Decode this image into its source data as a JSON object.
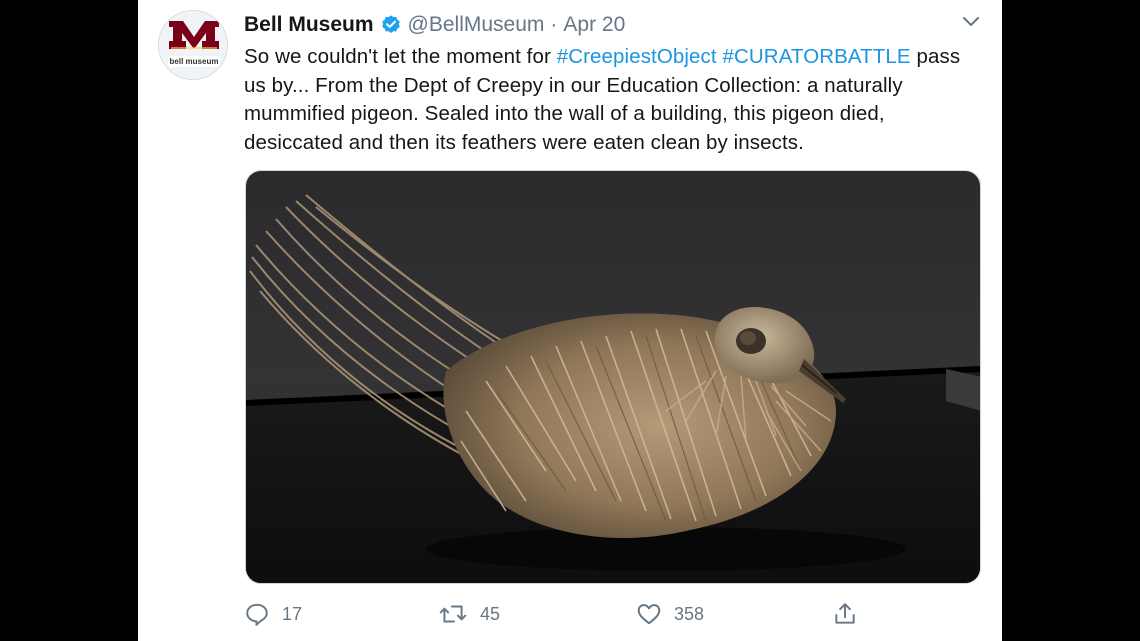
{
  "account": {
    "display_name": "Bell Museum",
    "handle": "@BellMuseum",
    "separator": "·",
    "date": "Apr 20",
    "avatar_logo_text": "bell museum"
  },
  "tweet": {
    "line1_pre": "So we couldn't let the moment for ",
    "hashtag1": "#CreepiestObject",
    "line1_mid": " ",
    "hashtag2": "#CURATORBATTLE",
    "line1_post": " pass",
    "line2": "us by... From the Dept of Creepy in our Education Collection: a naturally",
    "line3": "mummified pigeon. Sealed into the wall of a building, this pigeon died,",
    "line4": "desiccated and then its feathers were eaten clean by insects."
  },
  "metrics": {
    "replies": "17",
    "retweets": "45",
    "likes": "358"
  },
  "icons": {
    "verified": "verified-badge-icon",
    "caret": "chevron-down-icon",
    "reply": "reply-icon",
    "retweet": "retweet-icon",
    "like": "heart-icon",
    "share": "share-icon"
  },
  "colors": {
    "hashtag": "#1b95e0",
    "verified": "#1da1f2",
    "muted": "#657786",
    "text": "#14171a",
    "logo_maroon": "#7a0019"
  }
}
